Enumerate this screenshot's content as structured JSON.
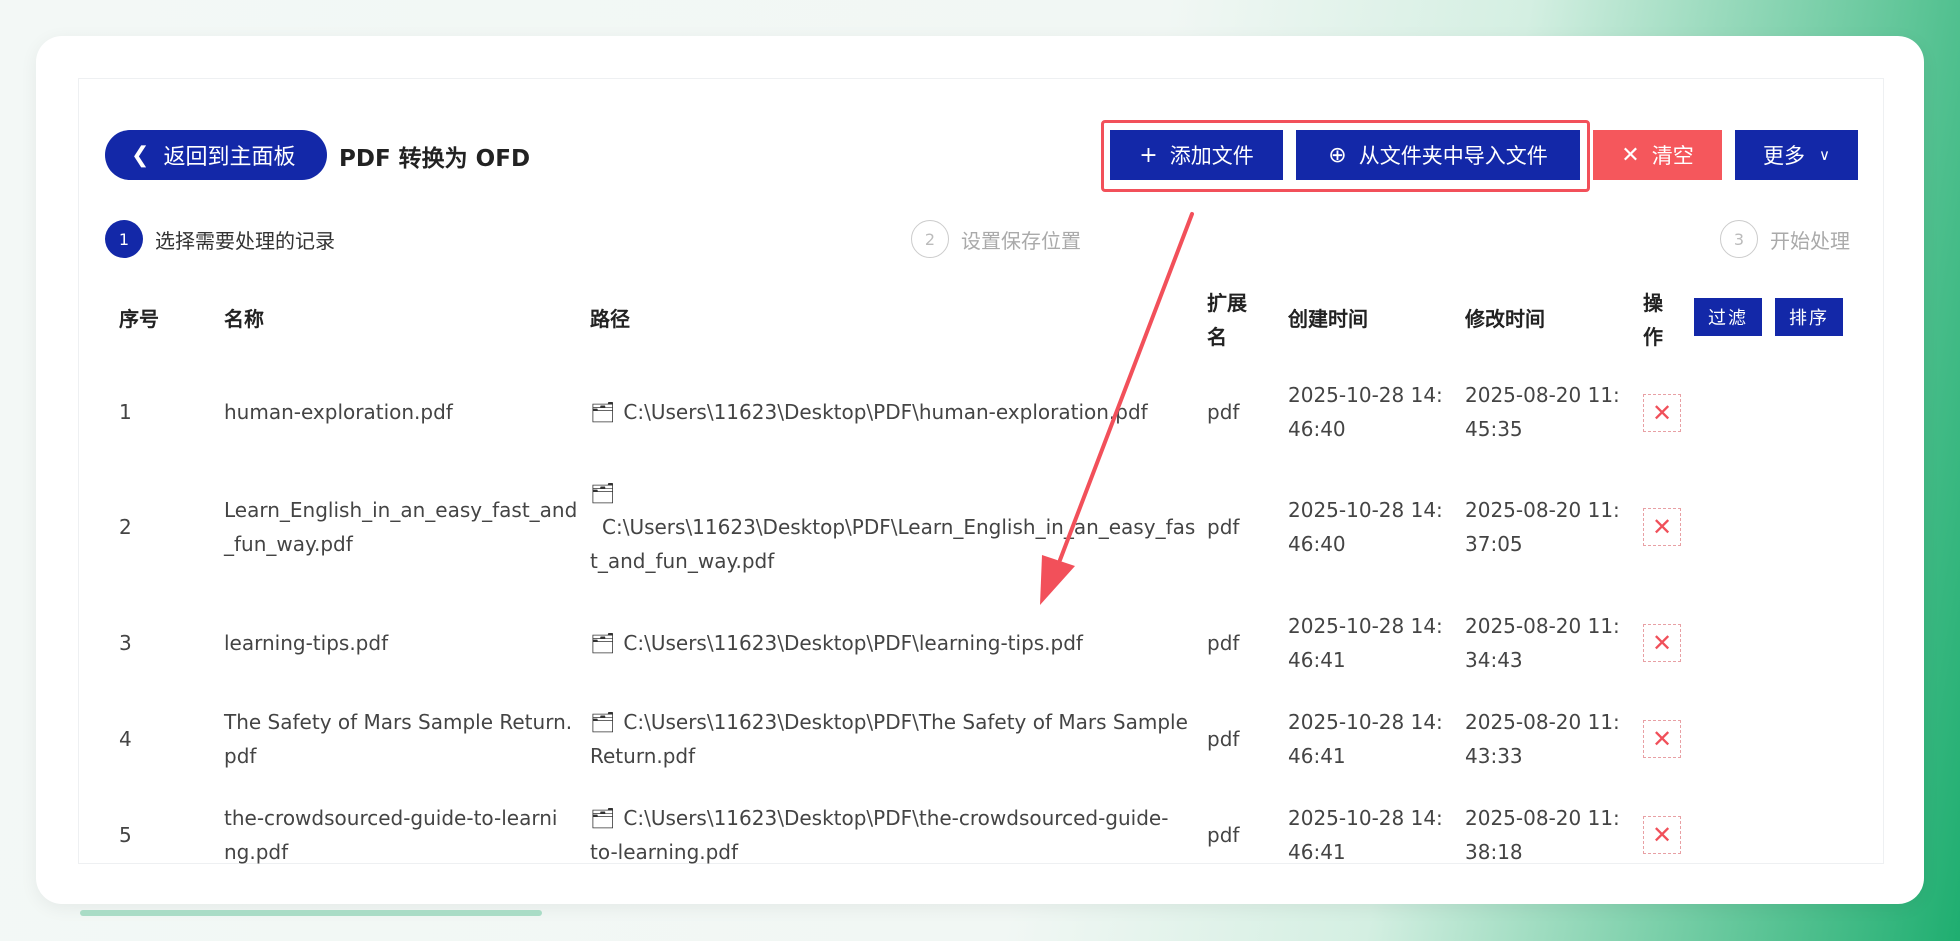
{
  "header": {
    "back_label": "返回到主面板",
    "title": "PDF 转换为 OFD",
    "add_file_label": "添加文件",
    "import_folder_label": "从文件夹中导入文件",
    "clear_label": "清空",
    "more_label": "更多"
  },
  "steps": [
    {
      "num": "1",
      "label": "选择需要处理的记录"
    },
    {
      "num": "2",
      "label": "设置保存位置"
    },
    {
      "num": "3",
      "label": "开始处理"
    }
  ],
  "table": {
    "headers": {
      "index": "序号",
      "name": "名称",
      "path": "路径",
      "ext_1": "扩展",
      "ext_2": "名",
      "created": "创建时间",
      "modified": "修改时间",
      "ops_1": "操",
      "ops_2": "作"
    },
    "filter_label": "过滤",
    "sort_label": "排序",
    "rows": [
      {
        "index": "1",
        "name": [
          "human-exploration.pdf"
        ],
        "path": [
          "C:\\Users\\11623\\Desktop\\PDF\\human-exploration.pdf"
        ],
        "ext": "pdf",
        "created": [
          "2025-10-28 14:",
          "46:40"
        ],
        "modified": [
          "2025-08-20 11:",
          "45:35"
        ]
      },
      {
        "index": "2",
        "name": [
          "Learn_English_in_an_easy_fast_and",
          "_fun_way.pdf"
        ],
        "path": [
          "C:\\Users\\11623\\Desktop\\PDF\\Learn_English_in_an_easy_fas",
          "t_and_fun_way.pdf"
        ],
        "ext": "pdf",
        "created": [
          "2025-10-28 14:",
          "46:40"
        ],
        "modified": [
          "2025-08-20 11:",
          "37:05"
        ]
      },
      {
        "index": "3",
        "name": [
          "learning-tips.pdf"
        ],
        "path": [
          "C:\\Users\\11623\\Desktop\\PDF\\learning-tips.pdf"
        ],
        "ext": "pdf",
        "created": [
          "2025-10-28 14:",
          "46:41"
        ],
        "modified": [
          "2025-08-20 11:",
          "34:43"
        ]
      },
      {
        "index": "4",
        "name": [
          "The Safety of Mars Sample Return.",
          "pdf"
        ],
        "path": [
          "C:\\Users\\11623\\Desktop\\PDF\\The Safety of Mars Sample",
          "Return.pdf"
        ],
        "ext": "pdf",
        "created": [
          "2025-10-28 14:",
          "46:41"
        ],
        "modified": [
          "2025-08-20 11:",
          "43:33"
        ]
      },
      {
        "index": "5",
        "name": [
          "the-crowdsourced-guide-to-learni",
          "ng.pdf"
        ],
        "path": [
          "C:\\Users\\11623\\Desktop\\PDF\\the-crowdsourced-guide-",
          "to-learning.pdf"
        ],
        "ext": "pdf",
        "created": [
          "2025-10-28 14:",
          "46:41"
        ],
        "modified": [
          "2025-08-20 11:",
          "38:18"
        ]
      }
    ]
  },
  "colors": {
    "primary": "#1328a8",
    "danger": "#f5575c",
    "annotation": "#f2505a"
  }
}
